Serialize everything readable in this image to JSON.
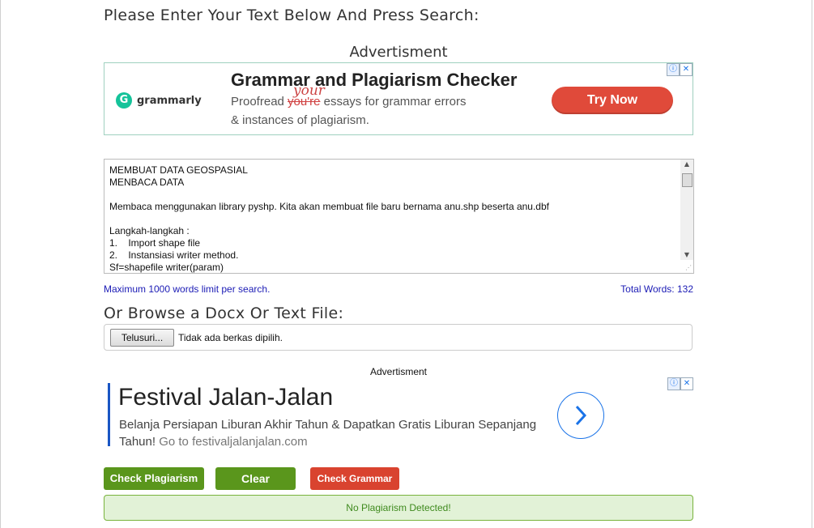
{
  "form": {
    "heading": "Please Enter Your Text Below And Press Search:",
    "textarea_text": "MEMBUAT DATA GEOSPASIAL\nMENBACA DATA\n\nMembaca menggunakan library pyshp. Kita akan membuat file baru bernama anu.shp beserta anu.dbf\n\nLangkah-langkah :\n1.    Import shape file\n2.    Instansiasi writer method.\nSf=shapefile writer(param)",
    "limit_note": "Maximum 1000 words limit per search.",
    "total_words": "Total Words: 132"
  },
  "ad_top": {
    "label": "Advertisment",
    "brand": "grammarly",
    "brand_initial": "G",
    "title": "Grammar and Plagiarism Checker",
    "line1_before": "Proofread ",
    "line1_strike": "you're",
    "line1_after": " essays for grammar errors",
    "handwritten_word": "your",
    "line2": "& instances of plagiarism.",
    "cta": "Try Now",
    "info_icon": "ⓘ",
    "close_icon": "✕"
  },
  "browse": {
    "heading": "Or Browse a Docx Or Text File:",
    "button_label": "Telusuri...",
    "status": "Tidak ada berkas dipilih."
  },
  "ad_bottom": {
    "label": "Advertisment",
    "title": "Festival Jalan-Jalan",
    "desc": "Belanja Persiapan Liburan Akhir Tahun & Dapatkan Gratis Liburan Sepanjang Tahun!",
    "url_text": " Go to festivaljalanjalan.com",
    "info_icon": "ⓘ",
    "close_icon": "✕"
  },
  "buttons": {
    "check_plagiarism": "Check Plagiarism",
    "clear": "Clear",
    "check_grammar": "Check Grammar"
  },
  "result": {
    "message": "No Plagiarism Detected!"
  },
  "colors": {
    "green_button": "#5a961c",
    "red_button": "#d9432f",
    "result_bg": "#e2f2d7",
    "link_blue": "#1b1bb5"
  }
}
